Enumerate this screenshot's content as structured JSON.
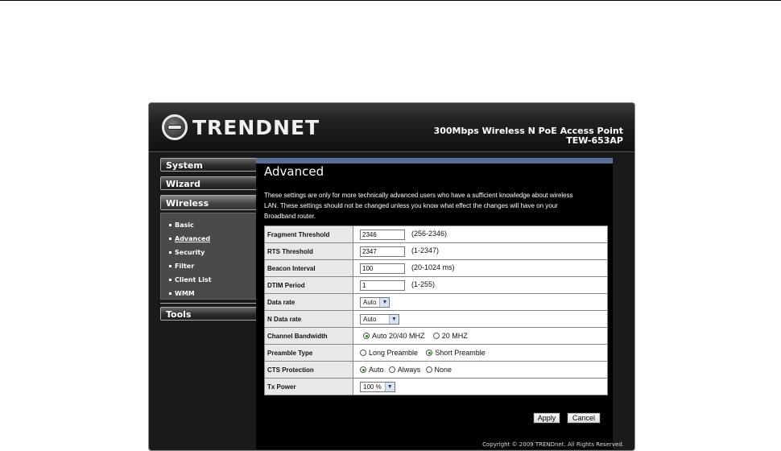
{
  "brand": {
    "logo_text": "TRENDNET",
    "product_name": "300Mbps Wireless N PoE Access Point",
    "model": "TEW-653AP"
  },
  "sidebar": {
    "system": "System",
    "wizard": "Wizard",
    "wireless": "Wireless",
    "wireless_items": [
      "Basic",
      "Advanced",
      "Security",
      "Filter",
      "Client List",
      "WMM"
    ],
    "tools": "Tools"
  },
  "page": {
    "title": "Advanced",
    "description_lines": [
      "These settings are only for more technically advanced users who have a sufficient knowledge about wireless",
      "LAN. These settings should not be changed unless you know what effect the changes will have on your",
      "Broadband router."
    ]
  },
  "settings": {
    "fragment_threshold": {
      "label": "Fragment Threshold",
      "value": "2346",
      "range": "(256-2346)"
    },
    "rts_threshold": {
      "label": "RTS Threshold",
      "value": "2347",
      "range": "(1-2347)"
    },
    "beacon_interval": {
      "label": "Beacon Interval",
      "value": "100",
      "range": "(20-1024 ms)"
    },
    "dtim_period": {
      "label": "DTIM Period",
      "value": "1",
      "range": "(1-255)"
    },
    "data_rate": {
      "label": "Data rate",
      "value": "Auto"
    },
    "n_data_rate": {
      "label": "N Data rate",
      "value": "Auto"
    },
    "channel_bandwidth": {
      "label": "Channel Bandwidth",
      "options": [
        "Auto 20/40 MHZ",
        "20 MHZ"
      ],
      "selected": 0
    },
    "preamble_type": {
      "label": "Preamble Type",
      "options": [
        "Long Preamble",
        "Short Preamble"
      ],
      "selected": 1
    },
    "cts_protection": {
      "label": "CTS Protection",
      "options": [
        "Auto",
        "Always",
        "None"
      ],
      "selected": 0
    },
    "tx_power": {
      "label": "Tx Power",
      "value": "100 %"
    }
  },
  "buttons": {
    "apply": "Apply",
    "cancel": "Cancel"
  },
  "footer": {
    "copyright": "Copyright © 2009 TRENDnet. All Rights Reserved."
  }
}
